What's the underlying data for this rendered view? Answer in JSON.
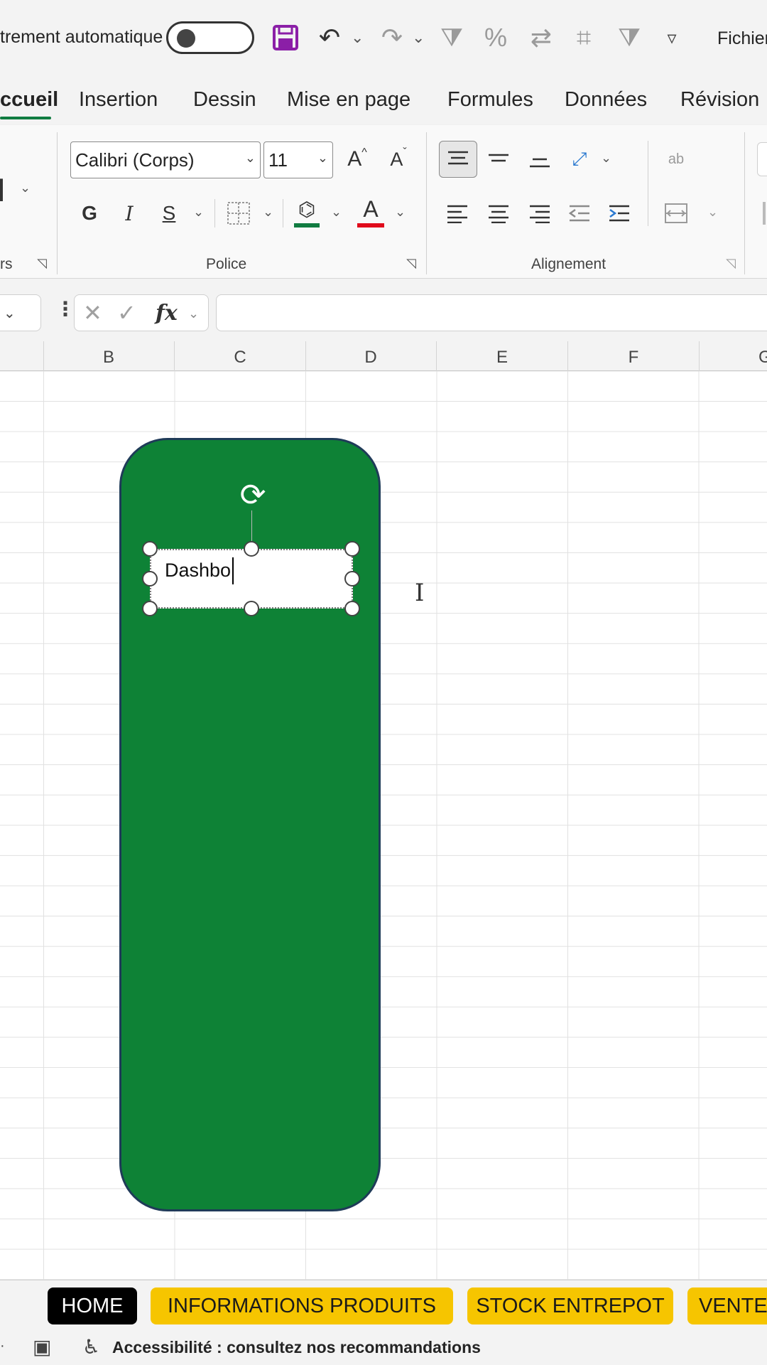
{
  "qat": {
    "autosave_label": "trement automatique",
    "fichier_label": "Fichier",
    "icons": {
      "save": "💾",
      "undo": "↶",
      "redo": "↷",
      "filter_clear": "⧩",
      "percent": "%",
      "icon_a": "⇄",
      "icon_b": "⌗",
      "icon_c": "⧩",
      "more": "▿"
    }
  },
  "tabs": [
    "ccueil",
    "Insertion",
    "Dessin",
    "Mise en page",
    "Formules",
    "Données",
    "Révision"
  ],
  "ribbon": {
    "font_name": "Calibri (Corps)",
    "font_size": "11",
    "grow_font": "A",
    "shrink_font": "A",
    "bold": "G",
    "italic": "I",
    "underline": "S",
    "font_color_letter": "A",
    "group_left_partial": "rs",
    "group_police": "Police",
    "group_alignement": "Alignement",
    "wrap_text": "ab",
    "fill_color": "#107c41",
    "font_color": "#e00b1c"
  },
  "formula": {
    "cancel": "✕",
    "confirm": "✓",
    "fx": "fx",
    "value": ""
  },
  "columns": [
    "B",
    "C",
    "D",
    "E",
    "F",
    "G"
  ],
  "shape": {
    "fill": "#0e8236",
    "text": "Dashbo"
  },
  "sheets": {
    "home": "HOME",
    "info": "INFORMATIONS PRODUITS",
    "stock": "STOCK ENTREPOT",
    "vente": "VENTE"
  },
  "status": {
    "accessibility": "Accessibilité : consultez nos recommandations"
  }
}
